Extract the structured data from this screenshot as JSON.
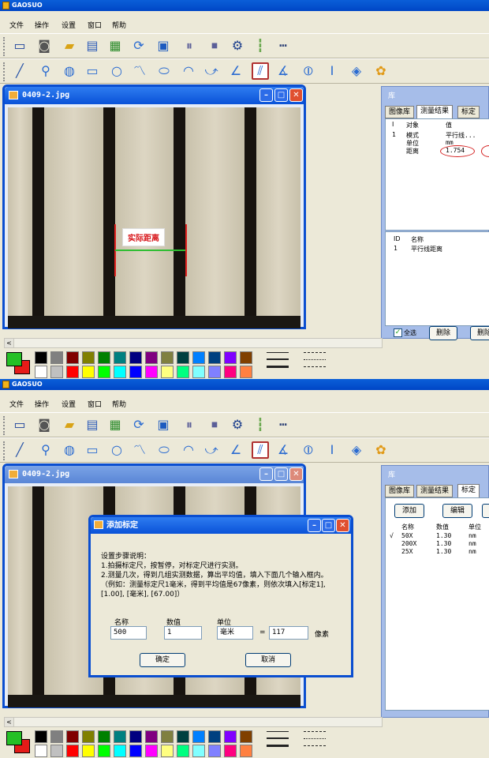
{
  "app": {
    "title": "GAOSUO"
  },
  "menu": [
    "文件",
    "操作",
    "设置",
    "窗口",
    "帮助"
  ],
  "toolbar_icons": [
    "new-icon",
    "camera-icon",
    "open-icon",
    "document-icon",
    "table-icon",
    "refresh-icon",
    "save-icon",
    "pause-icon",
    "stop-icon",
    "settings-icon",
    "ruler-icon",
    "scale-icon"
  ],
  "draw_icons": [
    "line-icon",
    "magnifier-icon",
    "zoom-icon",
    "rectangle-icon",
    "circle-icon",
    "polyline-icon",
    "ellipse-icon",
    "arc-icon",
    "curve-icon",
    "angle-tool-icon",
    "parallel-lines-icon",
    "angle-icon",
    "circle-center-icon",
    "line-width-icon",
    "point-icon",
    "palette-icon"
  ],
  "image_window": {
    "title": "0409-2.jpg",
    "annotation": "实际距离"
  },
  "panel1": {
    "library_title": "库",
    "tabs": [
      "图像库",
      "测量结果",
      "标定"
    ],
    "results_header": {
      "col1": "I",
      "col2": "对象",
      "col3": "值"
    },
    "results": [
      {
        "index": "1",
        "object": "模式",
        "value": "平行线..."
      },
      {
        "index": "",
        "object": "单位",
        "value": "mm"
      },
      {
        "index": "",
        "object": "距离",
        "value": "1.754"
      }
    ],
    "list_header": {
      "id": "ID",
      "name": "名称"
    },
    "list_rows": [
      {
        "id": "1",
        "name": "平行线距离"
      }
    ],
    "select_all": "全选",
    "delete_btn": "删除",
    "delete_btn2": "删除"
  },
  "panel2": {
    "library_title": "库",
    "tabs": [
      "图像库",
      "测量结果",
      "标定"
    ],
    "add_btn": "添加",
    "edit_btn": "编辑",
    "calib_header": {
      "name": "名称",
      "value": "数值",
      "unit": "单位"
    },
    "calib_rows": [
      {
        "mark": "√",
        "name": "50X",
        "value": "1.30",
        "unit": "nm"
      },
      {
        "mark": "",
        "name": "200X",
        "value": "1.30",
        "unit": "nm"
      },
      {
        "mark": "",
        "name": "25X",
        "value": "1.30",
        "unit": "nm"
      }
    ]
  },
  "dialog": {
    "title": "添加标定",
    "lines": [
      "设置步骤说明：",
      "1.拍摄标定尺，按暂停，对标定尺进行实测。",
      "2.测量几次，得到几组实测数据，算出平均值，填入下面几个输入框内。",
      "（例如：测量标定尺1毫米，得到平均值是67像素，则依次填入[标定1],",
      "[1.00], [毫米], [67.00]）"
    ],
    "labels": {
      "name": "名称",
      "value": "数值",
      "unit": "单位"
    },
    "fields": {
      "name": "500",
      "value": "1",
      "unit": "毫米",
      "pixels": "117"
    },
    "equals": "=",
    "pixel_unit": "像素",
    "ok": "确定",
    "cancel": "取消"
  },
  "colors": {
    "palette": [
      "#000000",
      "#808080",
      "#800000",
      "#808000",
      "#008000",
      "#008080",
      "#000080",
      "#800080",
      "#808040",
      "#004040",
      "#0080ff",
      "#004080",
      "#8000ff",
      "#804000",
      "#ffffff",
      "#c0c0c0",
      "#ff0000",
      "#ffff00",
      "#00ff00",
      "#00ffff",
      "#0000ff",
      "#ff00ff",
      "#ffff80",
      "#00ff80",
      "#80ffff",
      "#8080ff",
      "#ff0080",
      "#ff8040"
    ]
  }
}
